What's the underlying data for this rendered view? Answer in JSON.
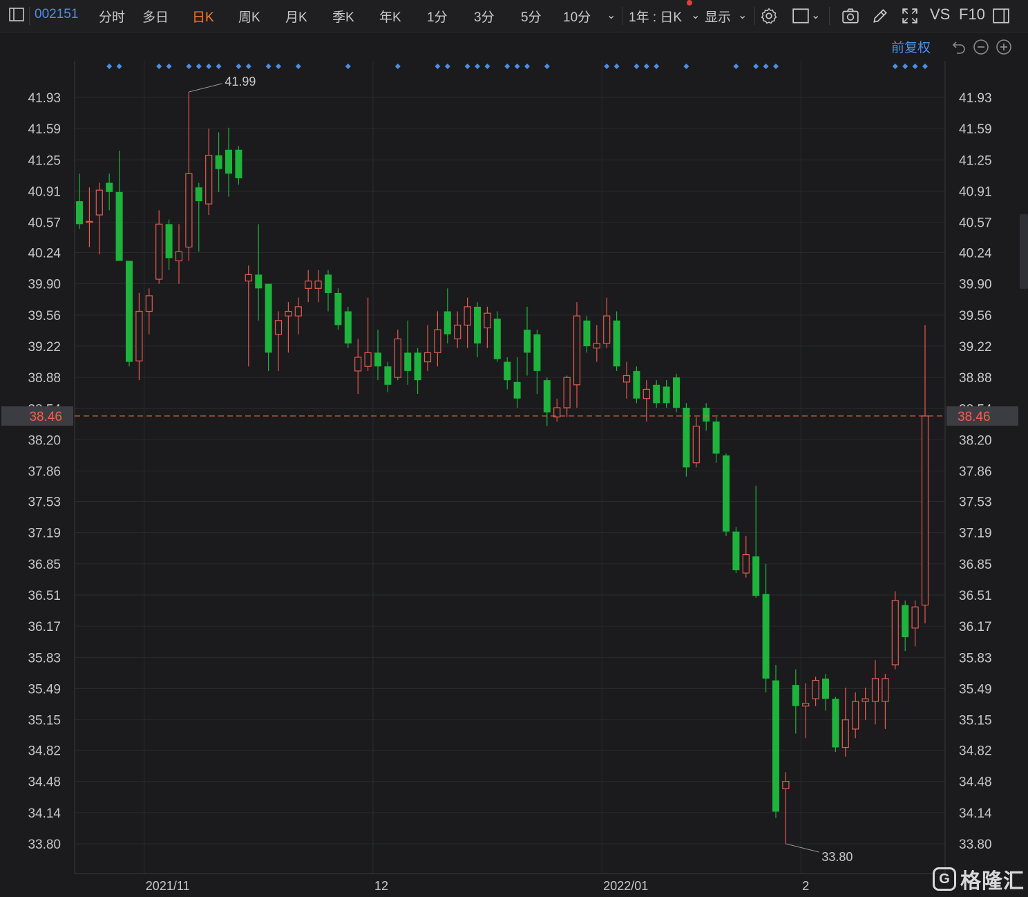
{
  "toolbar": {
    "code": "002151",
    "periods": [
      "分时",
      "多日",
      "日K",
      "周K",
      "月K",
      "季K",
      "年K",
      "1分",
      "3分",
      "5分",
      "10分"
    ],
    "active_period": "日K",
    "range_label": "1年 : 日K",
    "display_label": "显示",
    "vs_label": "VS",
    "f10_label": "F10"
  },
  "subbar": {
    "adjust_label": "前复权"
  },
  "brand": {
    "mark": "G",
    "name": "格隆汇"
  },
  "colors": {
    "up": "#e85a4f",
    "down": "#1db33c",
    "marker": "#4a8fe6",
    "price_line": "#e06a35",
    "grid": "#2a2b2e"
  },
  "chart_data": {
    "type": "candlestick",
    "ylim": [
      33.8,
      41.93
    ],
    "y_ticks": [
      "41.93",
      "41.59",
      "41.25",
      "40.91",
      "40.57",
      "40.24",
      "39.90",
      "39.56",
      "39.22",
      "38.88",
      "38.54",
      "38.20",
      "37.86",
      "37.53",
      "37.19",
      "36.85",
      "36.51",
      "36.17",
      "35.83",
      "35.49",
      "35.15",
      "34.82",
      "34.48",
      "34.14",
      "33.80"
    ],
    "x_labels": [
      {
        "label": "2021/11",
        "index": 7
      },
      {
        "label": "12",
        "index": 30
      },
      {
        "label": "2022/01",
        "index": 53
      },
      {
        "label": "2",
        "index": 73
      }
    ],
    "current_price": 38.46,
    "max_annotation": {
      "label": "41.99",
      "index": 11,
      "value": 41.99
    },
    "min_annotation": {
      "label": "33.80",
      "index": 71,
      "value": 33.8
    },
    "candles": [
      [
        40.8,
        40.55,
        41.1,
        40.5
      ],
      [
        40.58,
        40.58,
        40.95,
        40.3
      ],
      [
        40.65,
        40.92,
        41.0,
        40.22
      ],
      [
        41.0,
        40.9,
        41.1,
        40.7
      ],
      [
        40.9,
        40.15,
        41.35,
        40.15
      ],
      [
        40.15,
        39.05,
        40.15,
        39.0
      ],
      [
        39.06,
        39.6,
        39.8,
        38.85
      ],
      [
        39.6,
        39.77,
        39.85,
        39.35
      ],
      [
        39.95,
        40.55,
        40.7,
        39.9
      ],
      [
        40.55,
        40.18,
        40.6,
        40.05
      ],
      [
        40.15,
        40.25,
        40.55,
        39.9
      ],
      [
        40.3,
        41.1,
        41.99,
        40.15
      ],
      [
        40.95,
        40.8,
        41.0,
        40.25
      ],
      [
        40.77,
        41.3,
        41.59,
        40.65
      ],
      [
        41.3,
        41.15,
        41.55,
        40.9
      ],
      [
        41.36,
        41.1,
        41.6,
        40.85
      ],
      [
        41.36,
        41.05,
        41.4,
        40.98
      ],
      [
        39.93,
        40.0,
        40.1,
        39.0
      ],
      [
        40.0,
        39.85,
        40.55,
        39.5
      ],
      [
        39.9,
        39.15,
        39.9,
        38.95
      ],
      [
        39.35,
        39.5,
        39.6,
        38.95
      ],
      [
        39.55,
        39.6,
        39.7,
        39.15
      ],
      [
        39.55,
        39.65,
        39.75,
        39.35
      ],
      [
        39.85,
        39.93,
        40.05,
        39.7
      ],
      [
        39.85,
        39.93,
        40.05,
        39.7
      ],
      [
        40.0,
        39.8,
        40.05,
        39.6
      ],
      [
        39.8,
        39.45,
        39.85,
        39.4
      ],
      [
        39.6,
        39.25,
        39.65,
        39.2
      ],
      [
        38.95,
        39.1,
        39.3,
        38.7
      ],
      [
        39.0,
        39.15,
        39.75,
        38.95
      ],
      [
        39.15,
        39.0,
        39.4,
        38.85
      ],
      [
        39.0,
        38.8,
        39.05,
        38.72
      ],
      [
        38.88,
        39.3,
        39.4,
        38.85
      ],
      [
        39.15,
        38.95,
        39.5,
        38.8
      ],
      [
        39.15,
        38.85,
        39.2,
        38.7
      ],
      [
        39.05,
        39.15,
        39.45,
        38.95
      ],
      [
        39.15,
        39.4,
        39.6,
        39.0
      ],
      [
        39.6,
        39.35,
        39.85,
        39.25
      ],
      [
        39.3,
        39.45,
        39.6,
        39.2
      ],
      [
        39.45,
        39.65,
        39.75,
        39.2
      ],
      [
        39.65,
        39.25,
        39.7,
        39.1
      ],
      [
        39.42,
        39.58,
        39.65,
        39.2
      ],
      [
        39.52,
        39.08,
        39.6,
        39.05
      ],
      [
        39.05,
        38.85,
        39.1,
        38.75
      ],
      [
        38.83,
        38.65,
        39.1,
        38.55
      ],
      [
        39.4,
        39.15,
        39.65,
        38.9
      ],
      [
        39.35,
        38.95,
        39.4,
        38.7
      ],
      [
        38.85,
        38.5,
        38.88,
        38.35
      ],
      [
        38.45,
        38.55,
        38.65,
        38.4
      ],
      [
        38.55,
        38.88,
        38.9,
        38.45
      ],
      [
        38.8,
        39.55,
        39.7,
        38.55
      ],
      [
        39.5,
        39.22,
        39.55,
        39.15
      ],
      [
        39.2,
        39.25,
        39.45,
        39.05
      ],
      [
        39.25,
        39.55,
        39.75,
        39.2
      ],
      [
        39.5,
        39.0,
        39.6,
        38.95
      ],
      [
        38.83,
        38.9,
        39.05,
        38.65
      ],
      [
        38.95,
        38.65,
        39.0,
        38.6
      ],
      [
        38.65,
        38.75,
        38.85,
        38.4
      ],
      [
        38.8,
        38.6,
        38.85,
        38.55
      ],
      [
        38.78,
        38.6,
        38.85,
        38.55
      ],
      [
        38.88,
        38.55,
        38.92,
        38.5
      ],
      [
        38.55,
        37.9,
        38.6,
        37.8
      ],
      [
        37.95,
        38.35,
        38.45,
        37.9
      ],
      [
        38.55,
        38.4,
        38.6,
        38.3
      ],
      [
        38.4,
        38.05,
        38.45,
        37.95
      ],
      [
        38.03,
        37.2,
        38.05,
        37.15
      ],
      [
        37.2,
        36.78,
        37.25,
        36.75
      ],
      [
        36.75,
        36.95,
        37.15,
        36.7
      ],
      [
        36.93,
        36.5,
        37.7,
        36.48
      ],
      [
        36.52,
        35.6,
        36.85,
        35.45
      ],
      [
        35.58,
        34.15,
        35.75,
        34.08
      ],
      [
        34.4,
        34.48,
        34.58,
        33.8
      ],
      [
        35.53,
        35.3,
        35.7,
        35.0
      ],
      [
        35.3,
        35.33,
        35.55,
        34.95
      ],
      [
        35.38,
        35.58,
        35.62,
        35.3
      ],
      [
        35.6,
        35.38,
        35.65,
        35.25
      ],
      [
        35.38,
        34.85,
        35.4,
        34.8
      ],
      [
        34.85,
        35.15,
        35.5,
        34.75
      ],
      [
        35.05,
        35.35,
        35.45,
        34.95
      ],
      [
        35.35,
        35.38,
        35.5,
        35.15
      ],
      [
        35.35,
        35.6,
        35.8,
        35.1
      ],
      [
        35.35,
        35.6,
        35.65,
        35.05
      ],
      [
        35.75,
        36.45,
        36.55,
        35.7
      ],
      [
        36.4,
        36.05,
        36.45,
        35.9
      ],
      [
        36.15,
        36.38,
        36.45,
        35.95
      ],
      [
        36.4,
        38.46,
        39.45,
        36.2
      ]
    ],
    "signal_indices": [
      3,
      4,
      8,
      9,
      11,
      12,
      13,
      14,
      16,
      17,
      19,
      20,
      22,
      27,
      32,
      36,
      37,
      39,
      40,
      41,
      43,
      44,
      45,
      47,
      53,
      54,
      56,
      57,
      58,
      61,
      66,
      68,
      69,
      70,
      82,
      83,
      84,
      85
    ]
  }
}
